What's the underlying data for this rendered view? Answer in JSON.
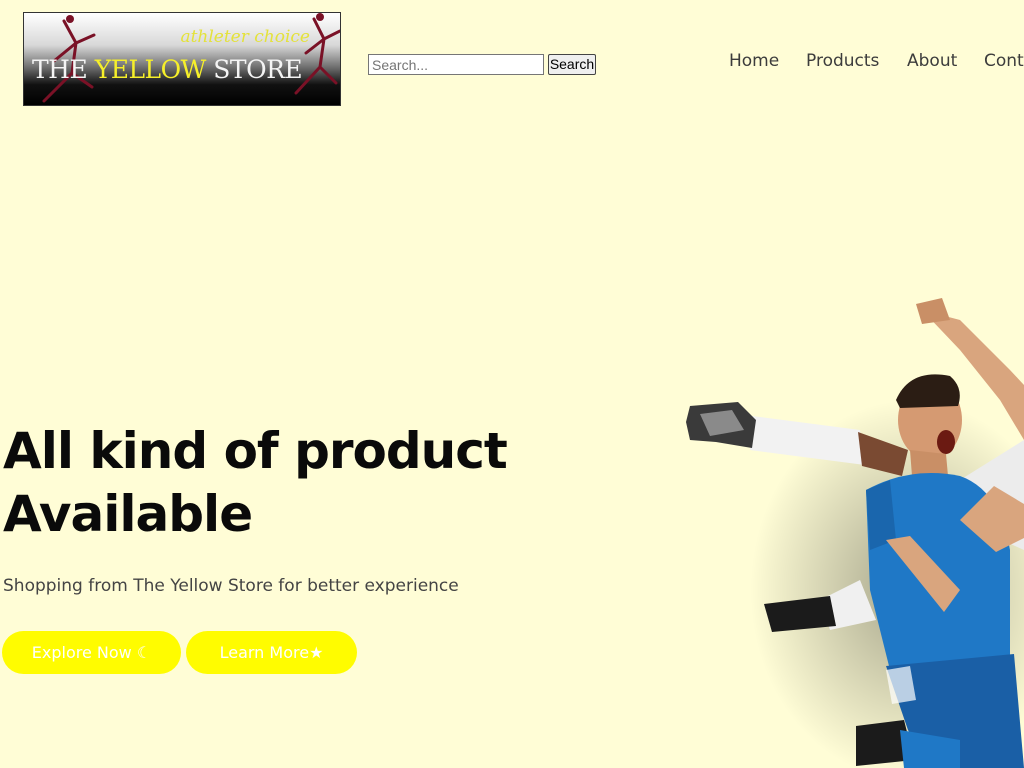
{
  "header": {
    "logo": {
      "tagline": "athleter choice",
      "name_prefix": "THE ",
      "name_highlight": "YELLOW",
      "name_suffix": " STORE"
    },
    "search": {
      "placeholder": "Search...",
      "value": "",
      "button_label": "Search"
    },
    "nav": [
      {
        "label": "Home"
      },
      {
        "label": "Products"
      },
      {
        "label": "About"
      },
      {
        "label": "Cont"
      }
    ]
  },
  "hero": {
    "title_line1": "All kind of product",
    "title_line2": "Available",
    "subtitle": "Shopping from The Yellow Store for better experience",
    "buttons": [
      {
        "label": "Explore Now ☾"
      },
      {
        "label": "Learn More★"
      }
    ]
  },
  "colors": {
    "background": "#fffdd6",
    "accent": "#fffc00",
    "jersey": "#1f78c6"
  }
}
